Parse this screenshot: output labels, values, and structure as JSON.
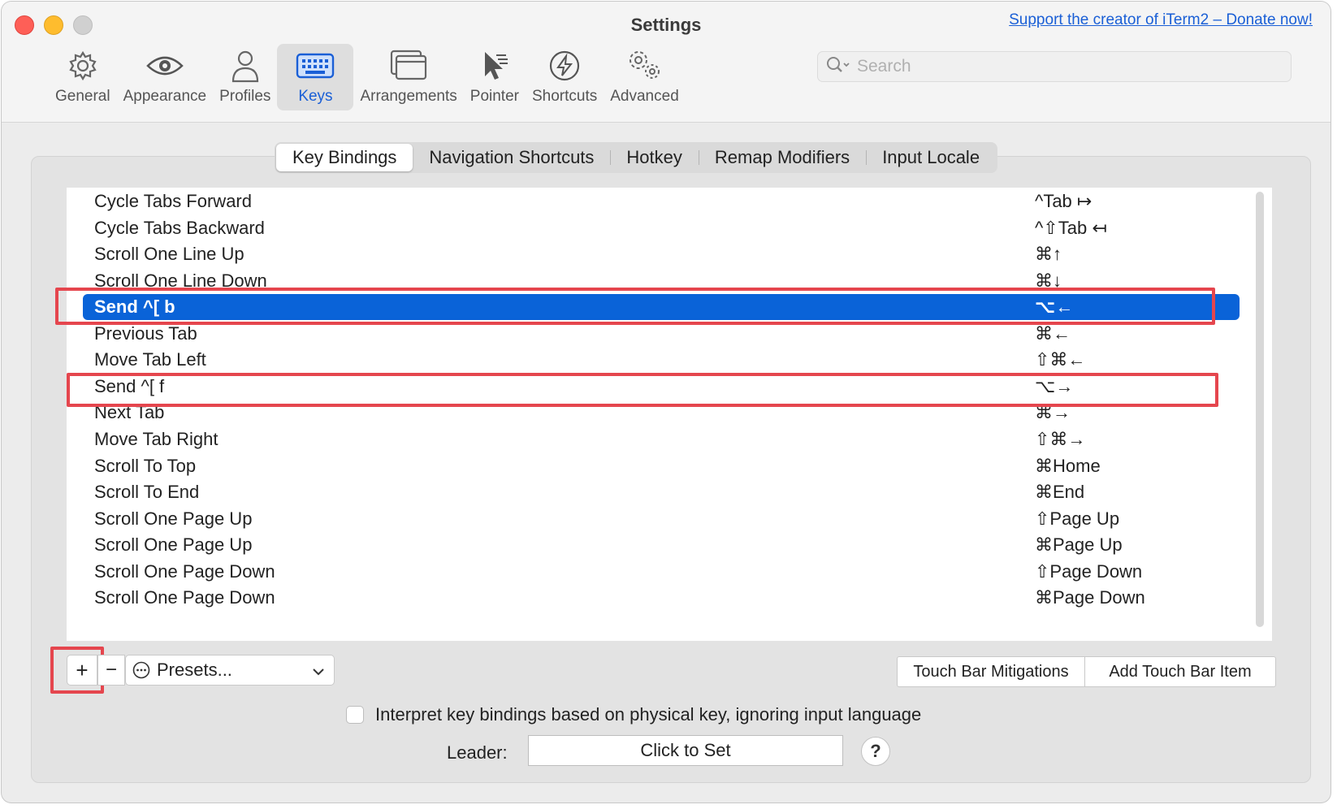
{
  "window": {
    "title": "Settings",
    "donate_link": "Support the creator of iTerm2 – Donate now!"
  },
  "toolbar": {
    "tabs": [
      {
        "label": "General",
        "icon": "gear-icon"
      },
      {
        "label": "Appearance",
        "icon": "eye-icon"
      },
      {
        "label": "Profiles",
        "icon": "person-icon"
      },
      {
        "label": "Keys",
        "icon": "keyboard-icon"
      },
      {
        "label": "Arrangements",
        "icon": "windows-icon"
      },
      {
        "label": "Pointer",
        "icon": "pointer-icon"
      },
      {
        "label": "Shortcuts",
        "icon": "lightning-icon"
      },
      {
        "label": "Advanced",
        "icon": "gears-icon"
      }
    ],
    "active_tab": "Keys"
  },
  "search": {
    "placeholder": "Search",
    "value": ""
  },
  "subtabs": {
    "items": [
      "Key Bindings",
      "Navigation Shortcuts",
      "Hotkey",
      "Remap Modifiers",
      "Input Locale"
    ],
    "active": "Key Bindings"
  },
  "bindings": [
    {
      "action": "Cycle Tabs Forward",
      "key": "^Tab ↦"
    },
    {
      "action": "Cycle Tabs Backward",
      "key": "^⇧Tab ↤"
    },
    {
      "action": "Scroll One Line Up",
      "key": "⌘↑"
    },
    {
      "action": "Scroll One Line Down",
      "key": "⌘↓"
    },
    {
      "action": "Send ^[ b",
      "key": "⌥←"
    },
    {
      "action": "Previous Tab",
      "key": "⌘←"
    },
    {
      "action": "Move Tab Left",
      "key": "⇧⌘←"
    },
    {
      "action": "Send ^[ f",
      "key": "⌥→"
    },
    {
      "action": "Next Tab",
      "key": "⌘→"
    },
    {
      "action": "Move Tab Right",
      "key": "⇧⌘→"
    },
    {
      "action": "Scroll To Top",
      "key": "⌘Home"
    },
    {
      "action": "Scroll To End",
      "key": "⌘End"
    },
    {
      "action": "Scroll One Page Up",
      "key": "⇧Page Up"
    },
    {
      "action": "Scroll One Page Up",
      "key": "⌘Page Up"
    },
    {
      "action": "Scroll One Page Down",
      "key": "⇧Page Down"
    },
    {
      "action": "Scroll One Page Down",
      "key": "⌘Page Down"
    }
  ],
  "selected_row": "Send ^[ b",
  "controls": {
    "add": "+",
    "remove": "−",
    "presets": "Presets...",
    "touch_bar_mitigations": "Touch Bar Mitigations",
    "add_touch_bar_item": "Add Touch Bar Item",
    "interpret_label": "Interpret key bindings based on physical key, ignoring input language",
    "interpret_checked": false,
    "leader_label": "Leader:",
    "leader_value": "Click to Set",
    "help": "?"
  },
  "colors": {
    "accent": "#0a63d8",
    "annotation": "#e5464e"
  }
}
